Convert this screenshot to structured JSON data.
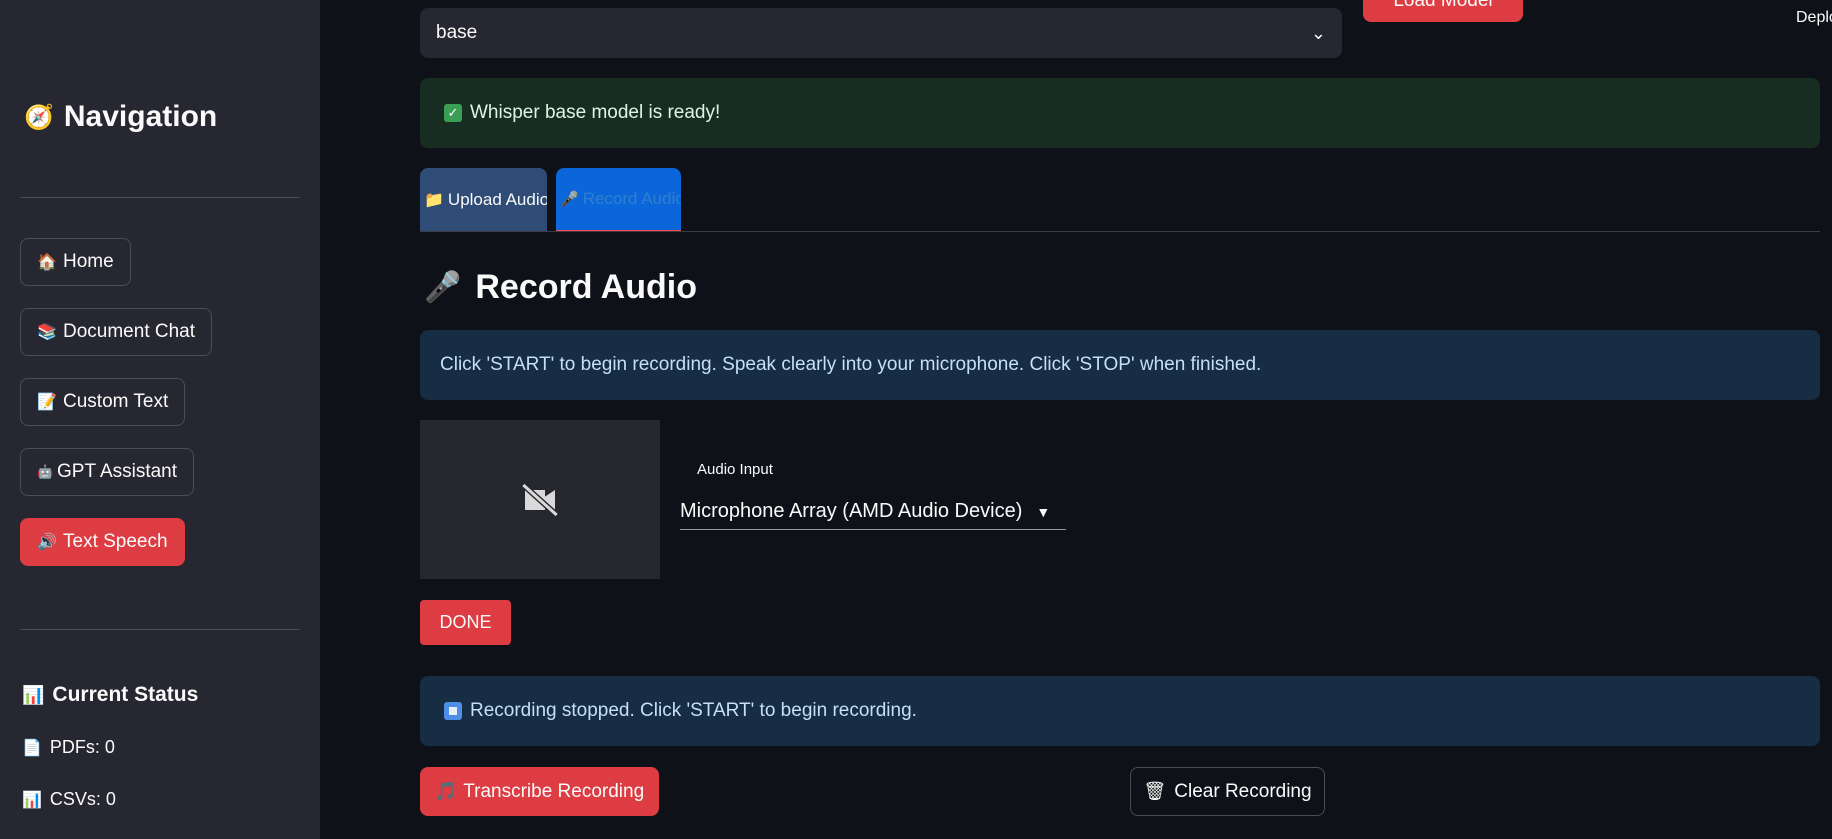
{
  "sidebar": {
    "title": "Navigation",
    "title_icon": "compass-icon",
    "items": [
      {
        "label": "Home",
        "icon": "house-icon"
      },
      {
        "label": "Document Chat",
        "icon": "books-icon"
      },
      {
        "label": "Custom Text",
        "icon": "memo-icon"
      },
      {
        "label": "GPT Assistant",
        "icon": "robot-icon"
      },
      {
        "label": "Text Speech",
        "icon": "speaker-icon",
        "active": true
      }
    ],
    "status": {
      "title": "Current Status",
      "pdfs": "PDFs: 0",
      "csvs": "CSVs: 0"
    }
  },
  "header": {
    "model_select_value": "base",
    "load_model_label": "Load Model",
    "deploy_label": "Deplo"
  },
  "success_message": "Whisper base model is ready!",
  "tabs": [
    {
      "label": "Upload Audio",
      "icon": "folder-icon"
    },
    {
      "label": "Record Audio",
      "icon": "microphone-icon",
      "active": true
    }
  ],
  "record": {
    "title": "Record Audio",
    "instructions": "Click 'START' to begin recording. Speak clearly into your microphone. Click 'STOP' when finished.",
    "audio_input_label": "Audio Input",
    "audio_input_value": "Microphone Array (AMD Audio Device)",
    "done_label": "DONE",
    "status_message": "Recording stopped. Click 'START' to begin recording.",
    "transcribe_label": "Transcribe Recording",
    "clear_label": "Clear Recording"
  },
  "colors": {
    "background": "#0e1117",
    "sidebar": "#262730",
    "primary": "#dc3c42",
    "success_bg": "#172d21",
    "info_bg": "#172d43",
    "active_tab": "#0b66d9"
  }
}
